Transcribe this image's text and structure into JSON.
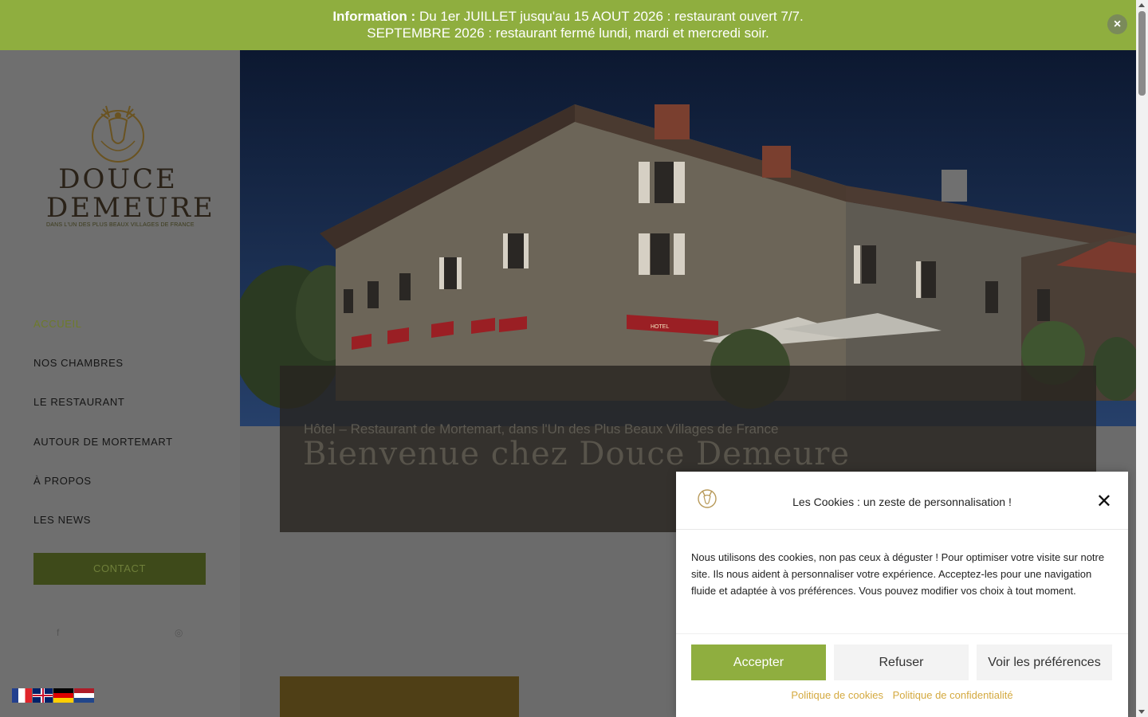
{
  "info_bar": {
    "label": "Information :",
    "line1": " Du 1er JUILLET jusqu'au 15 AOUT 2026 : restaurant ouvert 7/7.",
    "line2": "SEPTEMBRE 2026 : restaurant fermé lundi, mardi et mercredi soir.",
    "close_icon": "×"
  },
  "logo": {
    "name_line1": "DOUCE",
    "name_line2": "DEMEURE",
    "tagline": "DANS L'UN DES PLUS BEAUX VILLAGES DE FRANCE",
    "emblem_text": "Douce Demeure"
  },
  "nav": {
    "items": [
      {
        "label": "ACCUEIL",
        "active": true
      },
      {
        "label": "NOS CHAMBRES"
      },
      {
        "label": "LE RESTAURANT"
      },
      {
        "label": "AUTOUR DE MORTEMART"
      },
      {
        "label": "À PROPOS"
      },
      {
        "label": "LES NEWS"
      }
    ],
    "contact_label": "CONTACT"
  },
  "social": {
    "facebook_icon": "f",
    "instagram_icon": "◎"
  },
  "languages": [
    "fr",
    "en",
    "de",
    "nl"
  ],
  "hero": {
    "subtitle": "Hôtel – Restaurant de Mortemart, dans l'Un des Plus Beaux Villages de France",
    "title": "Bienvenue chez Douce Demeure",
    "awning_sign": "HOTEL"
  },
  "cookie": {
    "title": "Les Cookies : un zeste de personnalisation !",
    "close_icon": "✕",
    "body": "Nous utilisons des cookies, non pas ceux à déguster ! Pour optimiser votre visite sur notre site. Ils nous aident à personnaliser votre expérience. Acceptez-les pour une navigation fluide et adaptée à vos préférences. Vous pouvez modifier vos choix à tout moment.",
    "accept": "Accepter",
    "refuse": "Refuser",
    "preferences": "Voir les préférences",
    "link_cookies": "Politique de cookies",
    "link_privacy": "Politique de confidentialité"
  },
  "colors": {
    "accent_green": "#8fae3f",
    "dark_olive": "#3e4a1a",
    "link_gold": "#d4a93f"
  }
}
